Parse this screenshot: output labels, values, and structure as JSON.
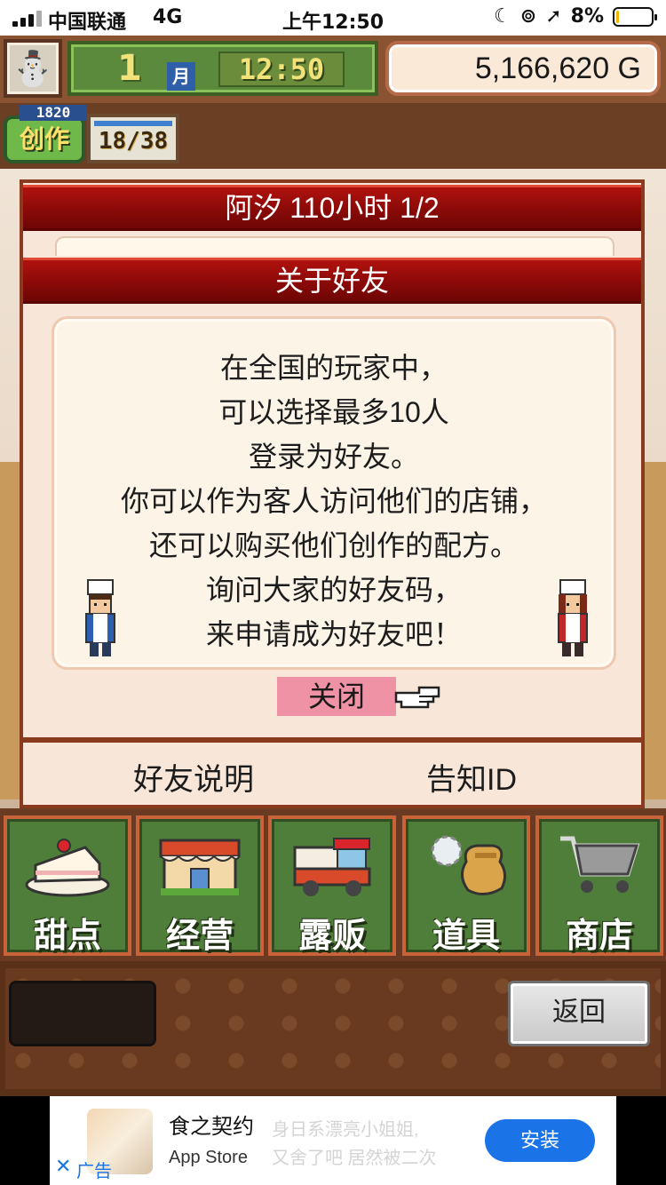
{
  "status_bar": {
    "carrier": "中国联通",
    "network": "4G",
    "time": "上午12:50",
    "battery": "8%",
    "battery_level": 0.08
  },
  "hud": {
    "month": "1",
    "month_label": "月",
    "game_time": "12:50",
    "gold": "5,166,620 G"
  },
  "creation": {
    "points": "1820",
    "label": "创作",
    "count": "18/38"
  },
  "dialog": {
    "header": "阿汐  110小时 1/2",
    "title": "关于好友",
    "lines": [
      "在全国的玩家中，",
      "可以选择最多10人",
      "登录为好友。",
      "你可以作为客人访问他们的店铺，",
      "还可以购买他们创作的配方。",
      "询问大家的好友码，",
      "来申请成为好友吧！"
    ],
    "close_label": "关闭"
  },
  "tabs": {
    "friend_help": "好友说明",
    "notify_id": "告知ID"
  },
  "menu": {
    "items": [
      {
        "label": "甜点",
        "icon": "cake-icon"
      },
      {
        "label": "经营",
        "icon": "shop-icon"
      },
      {
        "label": "露贩",
        "icon": "food-truck-icon"
      },
      {
        "label": "道具",
        "icon": "items-bag-icon"
      },
      {
        "label": "商店",
        "icon": "shopping-cart-icon"
      }
    ]
  },
  "back_label": "返回",
  "ad": {
    "title": "食之契约",
    "source": "App Store",
    "faded_text_1": "身日系漂亮小姐姐,",
    "faded_text_2": "又舍了吧 居然被二次",
    "install": "安装",
    "label": "广告",
    "close_glyph": "✕"
  },
  "colors": {
    "banner_red": "#9a0e0b",
    "close_highlight": "#ef92a6",
    "menu_green": "#4f7e3a",
    "install_blue": "#1b73e8"
  }
}
